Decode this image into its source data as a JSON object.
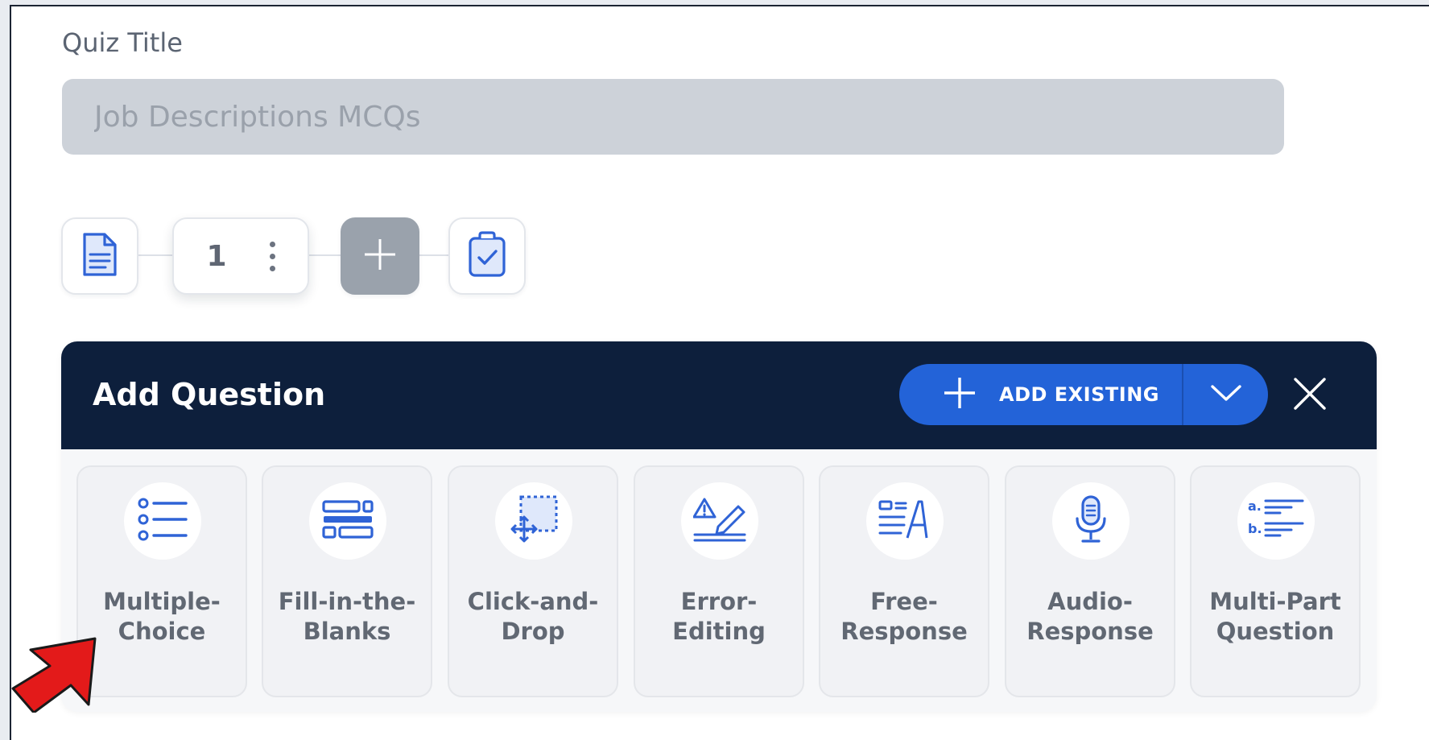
{
  "quiz": {
    "title_label": "Quiz Title",
    "title_placeholder": "Job Descriptions MCQs"
  },
  "question_nav": {
    "current_question_number": "1"
  },
  "add_question_panel": {
    "title": "Add Question",
    "add_existing_label": "ADD EXISTING",
    "question_types": [
      {
        "line1": "Multiple-",
        "line2": "Choice",
        "icon": "list-icon"
      },
      {
        "line1": "Fill-in-the-",
        "line2": "Blanks",
        "icon": "fill-blanks-icon"
      },
      {
        "line1": "Click-and-",
        "line2": "Drop",
        "icon": "drag-drop-icon"
      },
      {
        "line1": "Error-",
        "line2": "Editing",
        "icon": "error-edit-icon"
      },
      {
        "line1": "Free-",
        "line2": "Response",
        "icon": "free-response-icon"
      },
      {
        "line1": "Audio-",
        "line2": "Response",
        "icon": "microphone-icon"
      },
      {
        "line1": "Multi-Part",
        "line2": "Question",
        "icon": "multi-part-icon"
      }
    ]
  },
  "colors": {
    "accent_blue": "#2363d8",
    "header_navy": "#0d1f3c",
    "icon_blue": "#2f63d6",
    "pointer_arrow": "#e31a1a"
  }
}
